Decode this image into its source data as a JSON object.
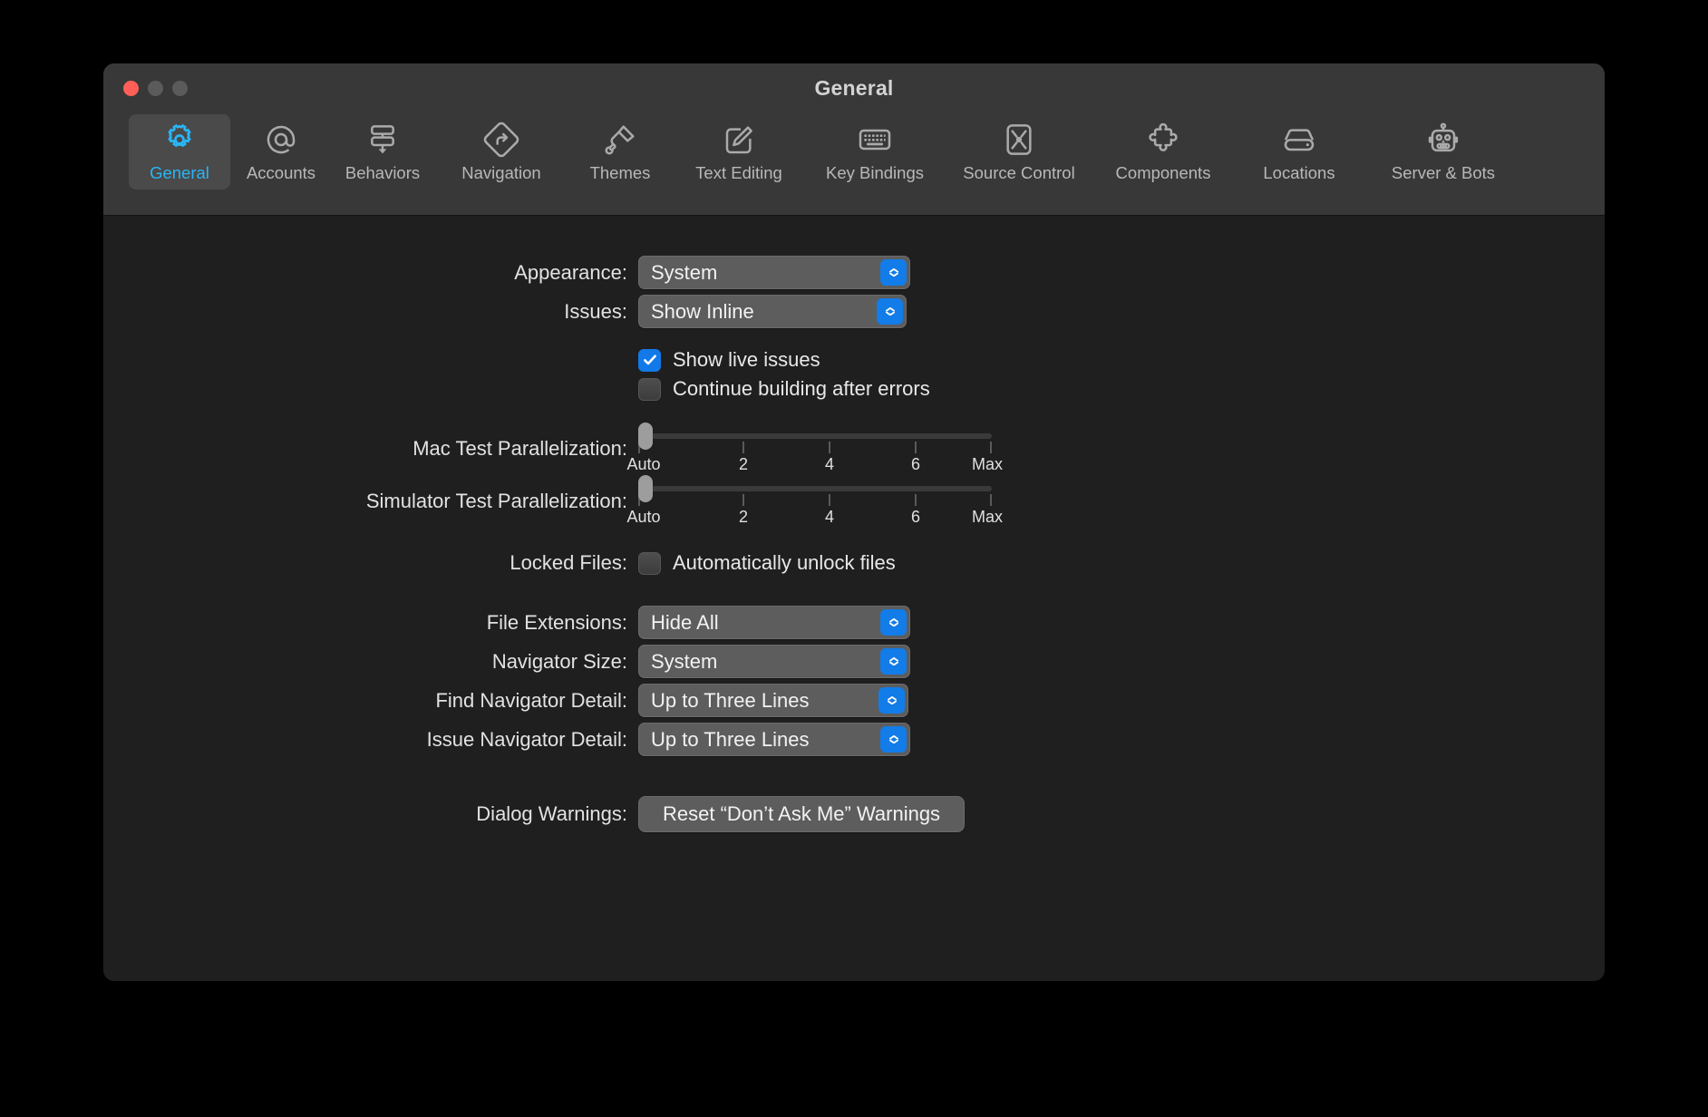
{
  "window": {
    "title": "General",
    "traffic_lights": [
      "close",
      "minimize",
      "zoom"
    ]
  },
  "toolbar": {
    "items": [
      {
        "label": "General",
        "icon": "gear-icon",
        "selected": true
      },
      {
        "label": "Accounts",
        "icon": "at-sign-icon",
        "selected": false
      },
      {
        "label": "Behaviors",
        "icon": "behaviors-icon",
        "selected": false
      },
      {
        "label": "Navigation",
        "icon": "navigation-icon",
        "selected": false
      },
      {
        "label": "Themes",
        "icon": "paintbrush-icon",
        "selected": false
      },
      {
        "label": "Text Editing",
        "icon": "text-editing-icon",
        "selected": false
      },
      {
        "label": "Key Bindings",
        "icon": "keyboard-icon",
        "selected": false
      },
      {
        "label": "Source Control",
        "icon": "source-control-icon",
        "selected": false
      },
      {
        "label": "Components",
        "icon": "puzzle-piece-icon",
        "selected": false
      },
      {
        "label": "Locations",
        "icon": "hard-drive-icon",
        "selected": false
      },
      {
        "label": "Server & Bots",
        "icon": "robot-icon",
        "selected": false
      }
    ]
  },
  "form": {
    "appearance": {
      "label": "Appearance:",
      "value": "System"
    },
    "issues": {
      "label": "Issues:",
      "value": "Show Inline"
    },
    "show_live_issues": {
      "label": "Show live issues",
      "checked": true
    },
    "continue_building": {
      "label": "Continue building after errors",
      "checked": false
    },
    "mac_parallelization": {
      "label": "Mac Test Parallelization:",
      "value": "Auto",
      "ticks": [
        "Auto",
        "2",
        "4",
        "6",
        "Max"
      ]
    },
    "simulator_parallelization": {
      "label": "Simulator Test Parallelization:",
      "value": "Auto",
      "ticks": [
        "Auto",
        "2",
        "4",
        "6",
        "Max"
      ]
    },
    "locked_files": {
      "label": "Locked Files:",
      "checkbox_label": "Automatically unlock files",
      "checked": false
    },
    "file_extensions": {
      "label": "File Extensions:",
      "value": "Hide All"
    },
    "navigator_size": {
      "label": "Navigator Size:",
      "value": "System"
    },
    "find_navigator_detail": {
      "label": "Find Navigator Detail:",
      "value": "Up to Three Lines"
    },
    "issue_navigator_detail": {
      "label": "Issue Navigator Detail:",
      "value": "Up to Three Lines"
    },
    "dialog_warnings": {
      "label": "Dialog Warnings:",
      "button": "Reset “Don’t Ask Me” Warnings"
    }
  },
  "colors": {
    "accent": "#127ce8",
    "selected_tab": "#2ab5f5",
    "close_button": "#ff5f57",
    "toolbar_bg": "#383838",
    "content_bg": "#1f1f1f"
  }
}
